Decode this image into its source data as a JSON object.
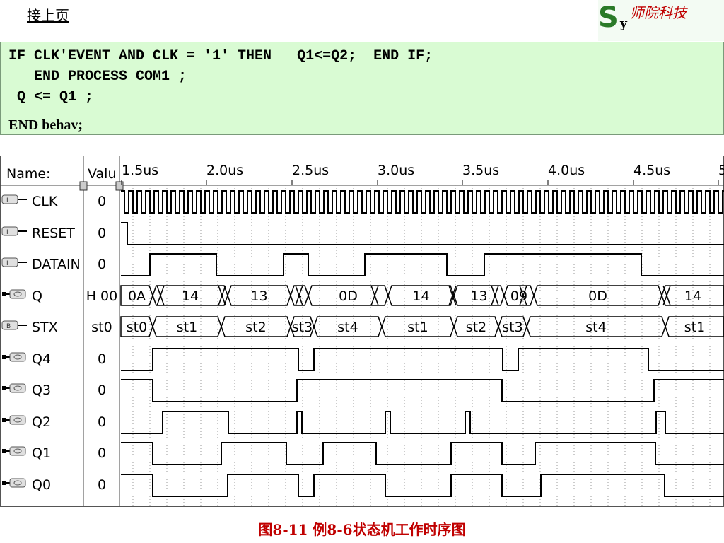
{
  "header": {
    "continued_label": "接上页"
  },
  "logo": {
    "letter_s": "S",
    "letter_y": "y",
    "text": "师院科技",
    "letter_color": "#2a7a28",
    "text_color": "#c00000"
  },
  "code": {
    "lines": [
      "IF CLK'EVENT AND CLK = '1' THEN   Q1<=Q2;  END IF;",
      "   END PROCESS COM1 ;",
      " Q <= Q1 ;",
      "END behav;"
    ],
    "background": "#d9fbd3"
  },
  "waveform": {
    "name_header": "Name:",
    "value_header": "Valu",
    "time_labels": [
      "1.5us",
      "2.0us",
      "2.5us",
      "3.0us",
      "3.5us",
      "4.0us",
      "4.5us",
      "5"
    ],
    "signals": [
      {
        "name": "CLK",
        "value": "0",
        "icon": "input-pin-icon"
      },
      {
        "name": "RESET",
        "value": "0",
        "icon": "input-pin-icon"
      },
      {
        "name": "DATAIN",
        "value": "0",
        "icon": "input-pin-icon"
      },
      {
        "name": "Q",
        "value": "H 00",
        "icon": "output-bus-icon"
      },
      {
        "name": "STX",
        "value": "st0",
        "icon": "state-bus-icon"
      },
      {
        "name": "Q4",
        "value": "0",
        "icon": "output-pin-icon"
      },
      {
        "name": "Q3",
        "value": "0",
        "icon": "output-pin-icon"
      },
      {
        "name": "Q2",
        "value": "0",
        "icon": "output-pin-icon"
      },
      {
        "name": "Q1",
        "value": "0",
        "icon": "output-pin-icon"
      },
      {
        "name": "Q0",
        "value": "0",
        "icon": "output-pin-icon"
      }
    ],
    "q_bus_values": [
      "0A",
      "14",
      "13",
      "-",
      "0D",
      "14",
      "13",
      "09",
      "0D",
      "14"
    ],
    "stx_bus_values": [
      "st0",
      "st1",
      "st2",
      "st3",
      "st4",
      "st1",
      "st2",
      "st3",
      "st4",
      "st1"
    ]
  },
  "caption": "图8-11  例8-6状态机工作时序图"
}
